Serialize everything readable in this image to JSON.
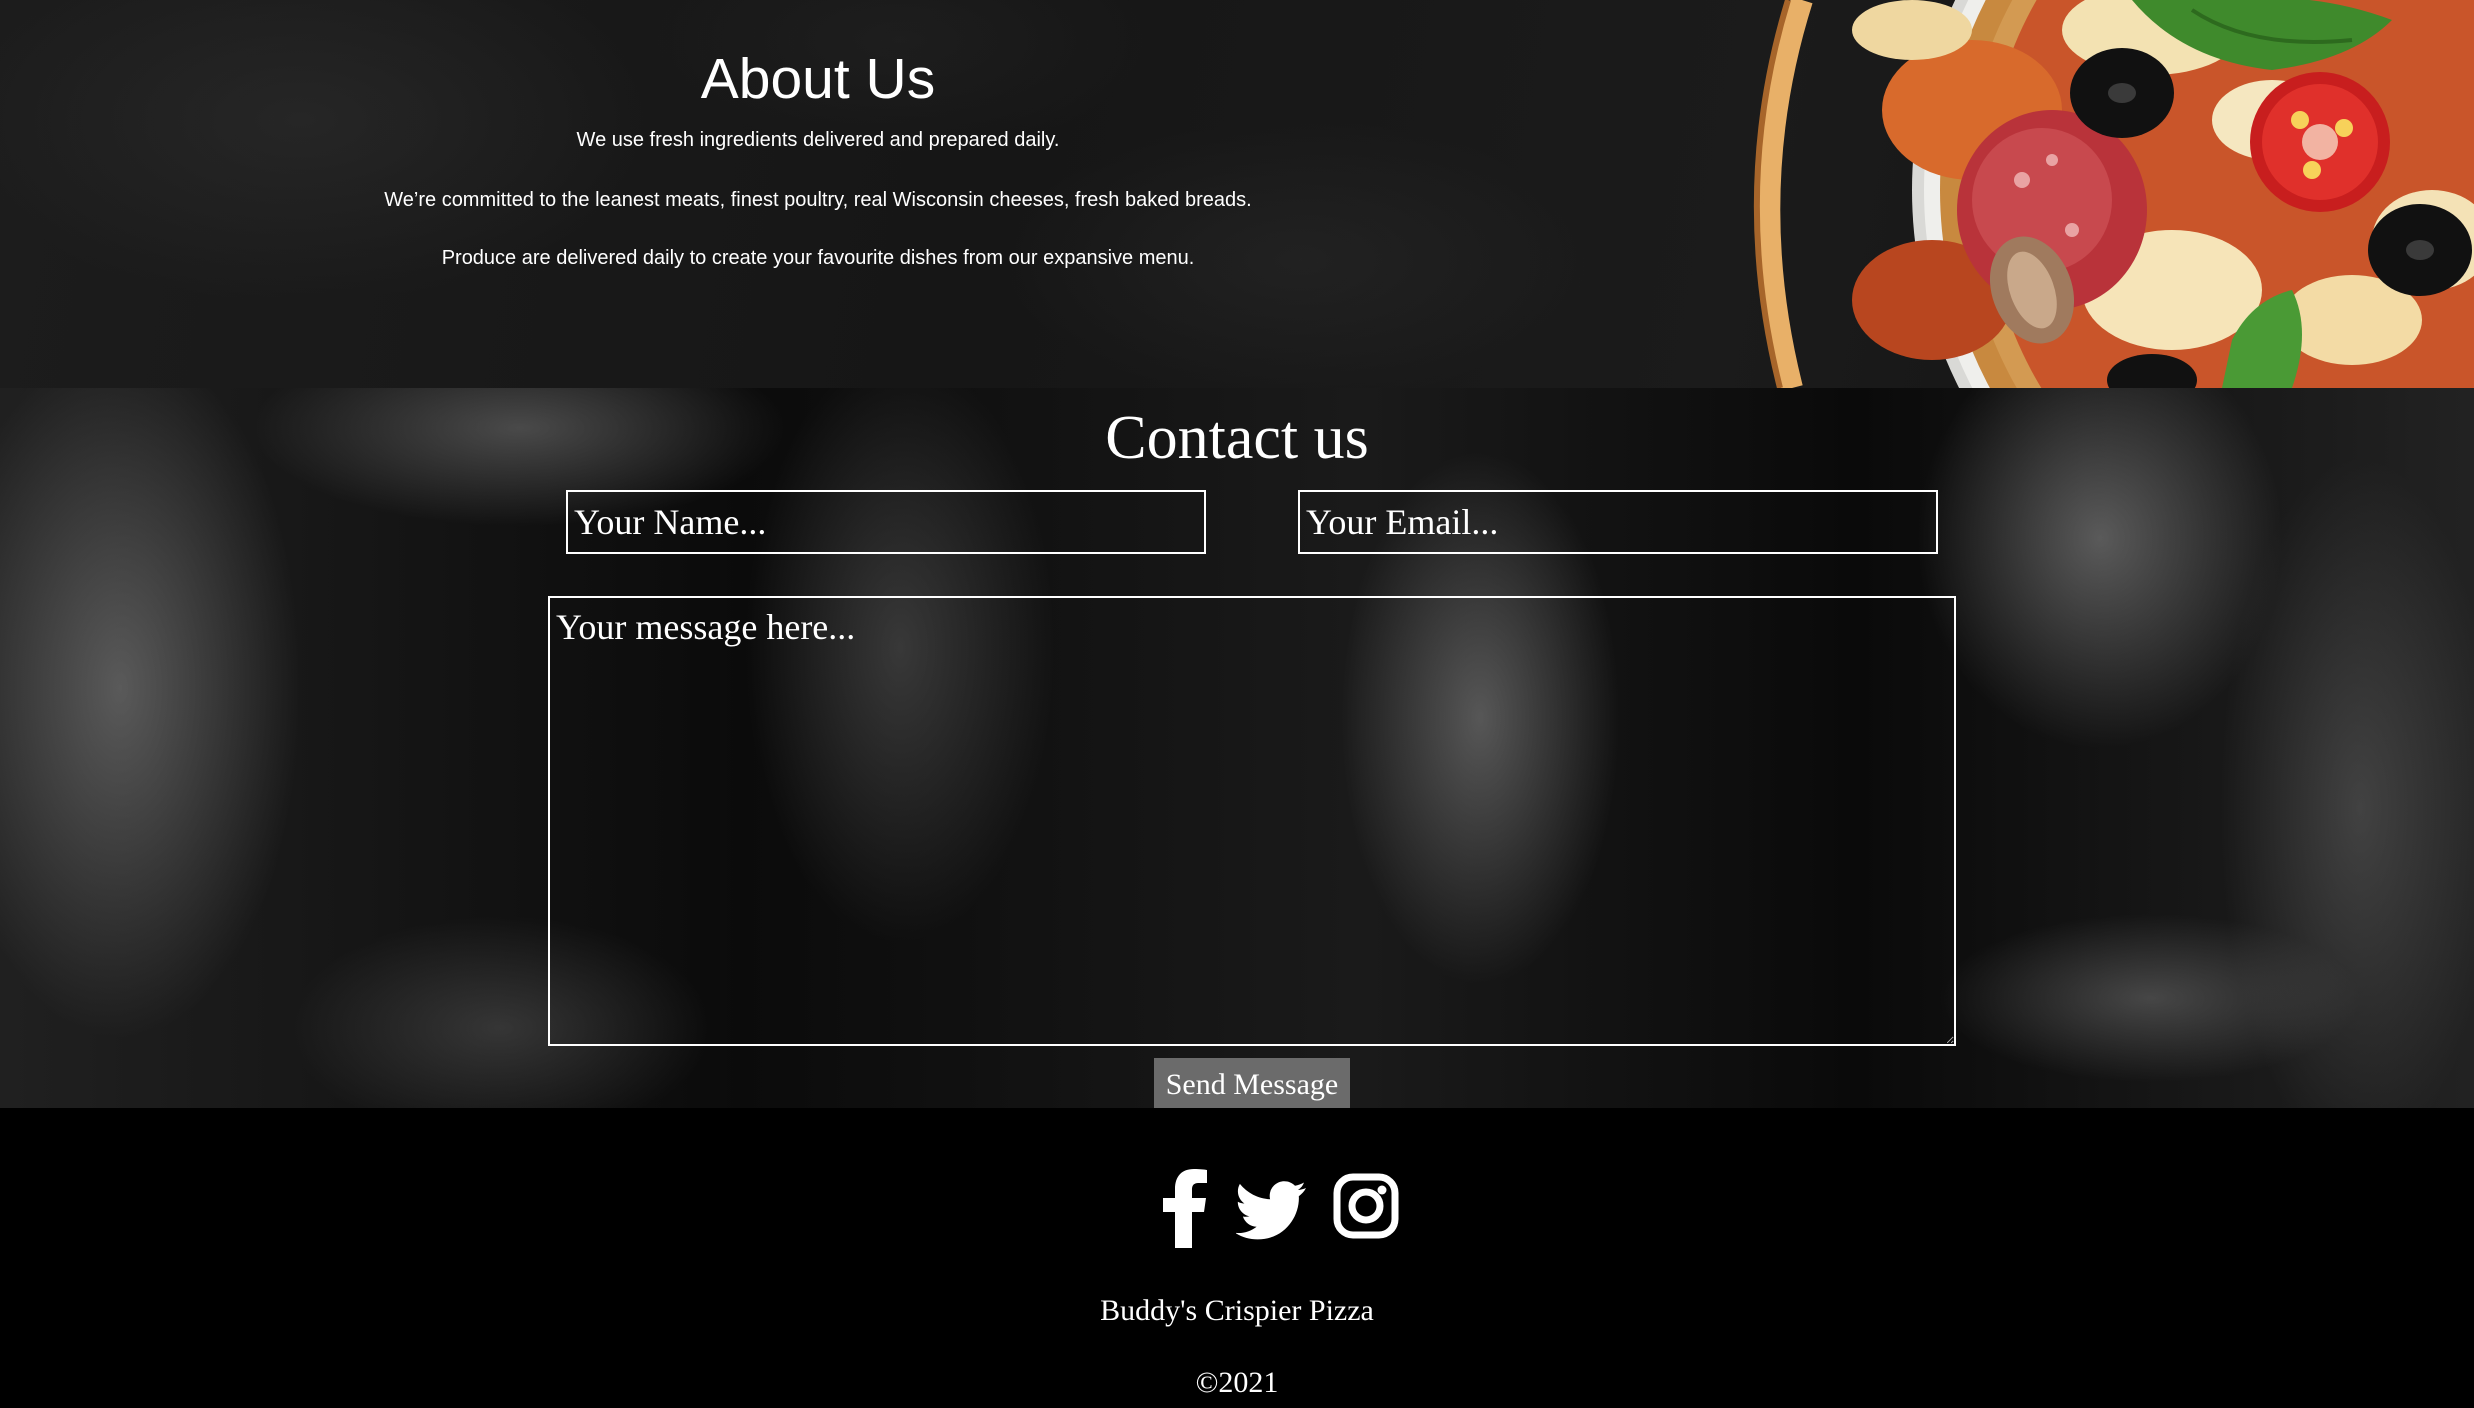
{
  "about": {
    "title": "About Us",
    "lines": [
      "We use fresh ingredients delivered and prepared daily.",
      "We’re committed to the leanest meats, finest poultry, real Wisconsin cheeses, fresh baked breads.",
      "Produce are delivered daily to create your favourite dishes from our expansive menu."
    ],
    "image_icon": "pizza-photo"
  },
  "contact": {
    "title": "Contact us",
    "name_placeholder": "Your Name...",
    "email_placeholder": "Your Email...",
    "message_placeholder": "Your message here...",
    "send_label": "Send Message"
  },
  "footer": {
    "social": [
      "facebook-icon",
      "twitter-icon",
      "instagram-icon"
    ],
    "brand": "Buddy's Crispier Pizza",
    "copyright": "©2021"
  },
  "colors": {
    "about_bg": "#1a1a1a",
    "footer_bg": "#000000",
    "button_bg": "#6b6b6b",
    "text": "#ffffff"
  }
}
